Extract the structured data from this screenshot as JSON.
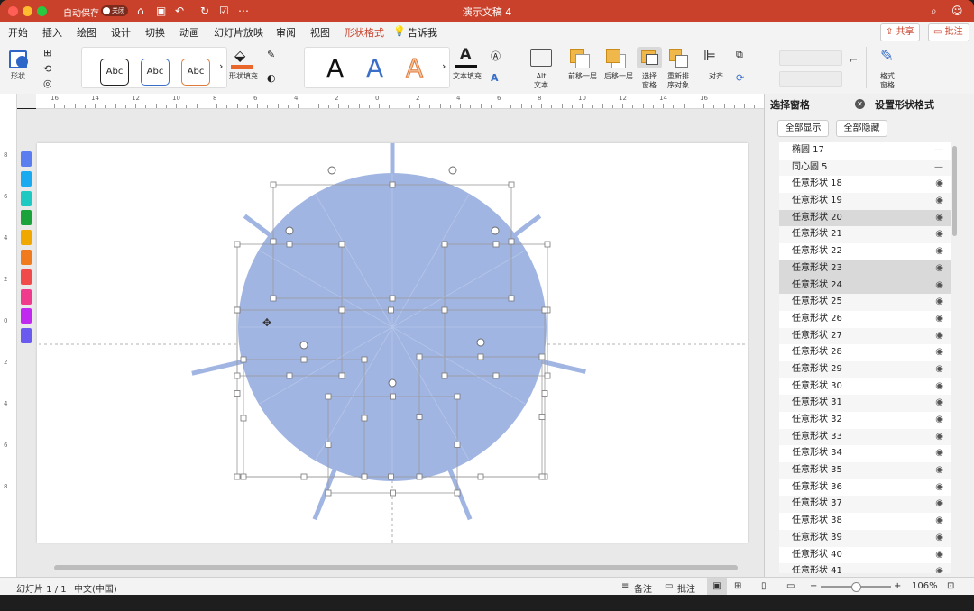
{
  "titlebar": {
    "autosave_label": "自动保存",
    "autosave_state": "关闭",
    "title": "演示文稿 4",
    "colors": {
      "bar": "#c9412a"
    }
  },
  "tabs": [
    {
      "label": "开始"
    },
    {
      "label": "插入"
    },
    {
      "label": "绘图"
    },
    {
      "label": "设计"
    },
    {
      "label": "切换"
    },
    {
      "label": "动画"
    },
    {
      "label": "幻灯片放映"
    },
    {
      "label": "审阅"
    },
    {
      "label": "视图"
    },
    {
      "label": "形状格式",
      "active": true
    },
    {
      "label": "告诉我"
    }
  ],
  "share_label": "共享",
  "comment_label": "批注",
  "ribbon": {
    "shape_label": "形状",
    "style_samples": [
      "Abc",
      "Abc",
      "Abc"
    ],
    "shape_fill_label": "形状填充",
    "wordart_samples": [
      "A",
      "A",
      "A"
    ],
    "text_fill_label": "文本填充",
    "alt_text_label": "Alt\n文本",
    "bring_forward_label": "前移一层",
    "send_backward_label": "后移一层",
    "selection_pane_label": "选择\n窗格",
    "reorder_label": "重新排\n序对象",
    "align_label": "对齐",
    "format_pane_label": "格式\n窗格"
  },
  "ruler_ticks": [
    "16",
    "14",
    "12",
    "10",
    "8",
    "6",
    "4",
    "2",
    "0",
    "2",
    "4",
    "6",
    "8",
    "10",
    "12",
    "14",
    "16"
  ],
  "vruler_ticks": [
    "8",
    "6",
    "4",
    "2",
    "0",
    "2",
    "4",
    "6",
    "8"
  ],
  "slide_colors": [
    "#5a7ef0",
    "#19aaf0",
    "#1ec9c1",
    "#1aa33a",
    "#f0a800",
    "#f07a1e",
    "#f04a4a",
    "#f03a8c",
    "#c02af0",
    "#6a5af0"
  ],
  "selection_pane": {
    "title": "选择窗格",
    "format_title": "设置形状格式",
    "show_all": "全部显示",
    "hide_all": "全部隐藏",
    "items": [
      {
        "name": "椭圆 17",
        "state": "—"
      },
      {
        "name": "同心圆 5",
        "state": "—"
      },
      {
        "name": "任意形状 18",
        "state": "eye"
      },
      {
        "name": "任意形状 19",
        "state": "eye"
      },
      {
        "name": "任意形状 20",
        "state": "eye",
        "selected": true
      },
      {
        "name": "任意形状 21",
        "state": "eye"
      },
      {
        "name": "任意形状 22",
        "state": "eye"
      },
      {
        "name": "任意形状 23",
        "state": "eye",
        "selected": true
      },
      {
        "name": "任意形状 24",
        "state": "eye",
        "selected": true
      },
      {
        "name": "任意形状 25",
        "state": "eye"
      },
      {
        "name": "任意形状 26",
        "state": "eye"
      },
      {
        "name": "任意形状 27",
        "state": "eye"
      },
      {
        "name": "任意形状 28",
        "state": "eye"
      },
      {
        "name": "任意形状 29",
        "state": "eye"
      },
      {
        "name": "任意形状 30",
        "state": "eye"
      },
      {
        "name": "任意形状 31",
        "state": "eye"
      },
      {
        "name": "任意形状 32",
        "state": "eye"
      },
      {
        "name": "任意形状 33",
        "state": "eye"
      },
      {
        "name": "任意形状 34",
        "state": "eye"
      },
      {
        "name": "任意形状 35",
        "state": "eye"
      },
      {
        "name": "任意形状 36",
        "state": "eye"
      },
      {
        "name": "任意形状 37",
        "state": "eye"
      },
      {
        "name": "任意形状 38",
        "state": "eye"
      },
      {
        "name": "任意形状 39",
        "state": "eye"
      },
      {
        "name": "任意形状 40",
        "state": "eye"
      },
      {
        "name": "任意形状 41",
        "state": "eye"
      }
    ]
  },
  "status": {
    "slide_info": "幻灯片 1 / 1",
    "language": "中文(中国)",
    "notes_label": "备注",
    "comments_label": "批注",
    "zoom": "106%"
  },
  "shape_color": "#a1b5e2"
}
